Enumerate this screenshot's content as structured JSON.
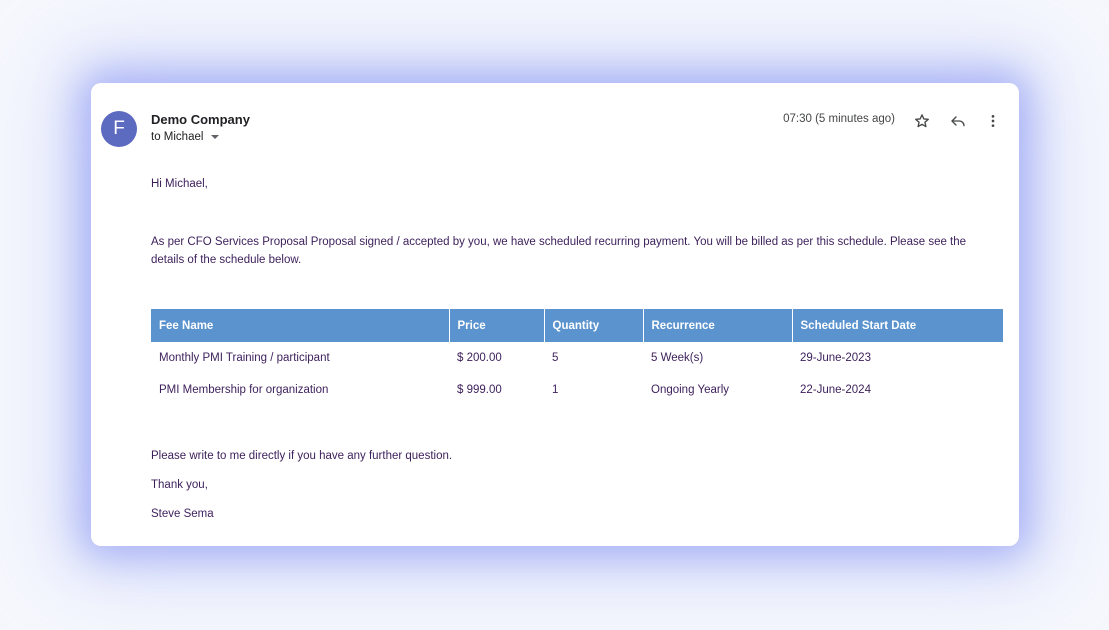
{
  "email": {
    "avatar_letter": "F",
    "sender": "Demo Company",
    "to_label": "to Michael",
    "timestamp": "07:30 (5 minutes ago)",
    "icons": [
      "star-icon",
      "reply-icon",
      "more-vert-icon"
    ],
    "accent_color": "#5c6bc0",
    "greeting": "Hi Michael,",
    "intro": "As per CFO Services Proposal Proposal  signed / accepted by you, we have scheduled recurring payment. You will be billed as per this schedule. Please see the details of the schedule below.",
    "closing": "Please write to me directly if you have any further question.",
    "thanks": "Thank you,",
    "signature": "Steve Sema"
  },
  "table": {
    "header_color": "#5a93ce",
    "headers": [
      "Fee Name",
      "Price",
      "Quantity",
      "Recurrence",
      "Scheduled Start Date"
    ],
    "rows": [
      [
        "Monthly PMI Training / participant",
        "$ 200.00",
        "5",
        "5 Week(s)",
        "29-June-2023"
      ],
      [
        "PMI Membership for organization",
        "$ 999.00",
        "1",
        "Ongoing Yearly",
        "22-June-2024"
      ]
    ]
  }
}
